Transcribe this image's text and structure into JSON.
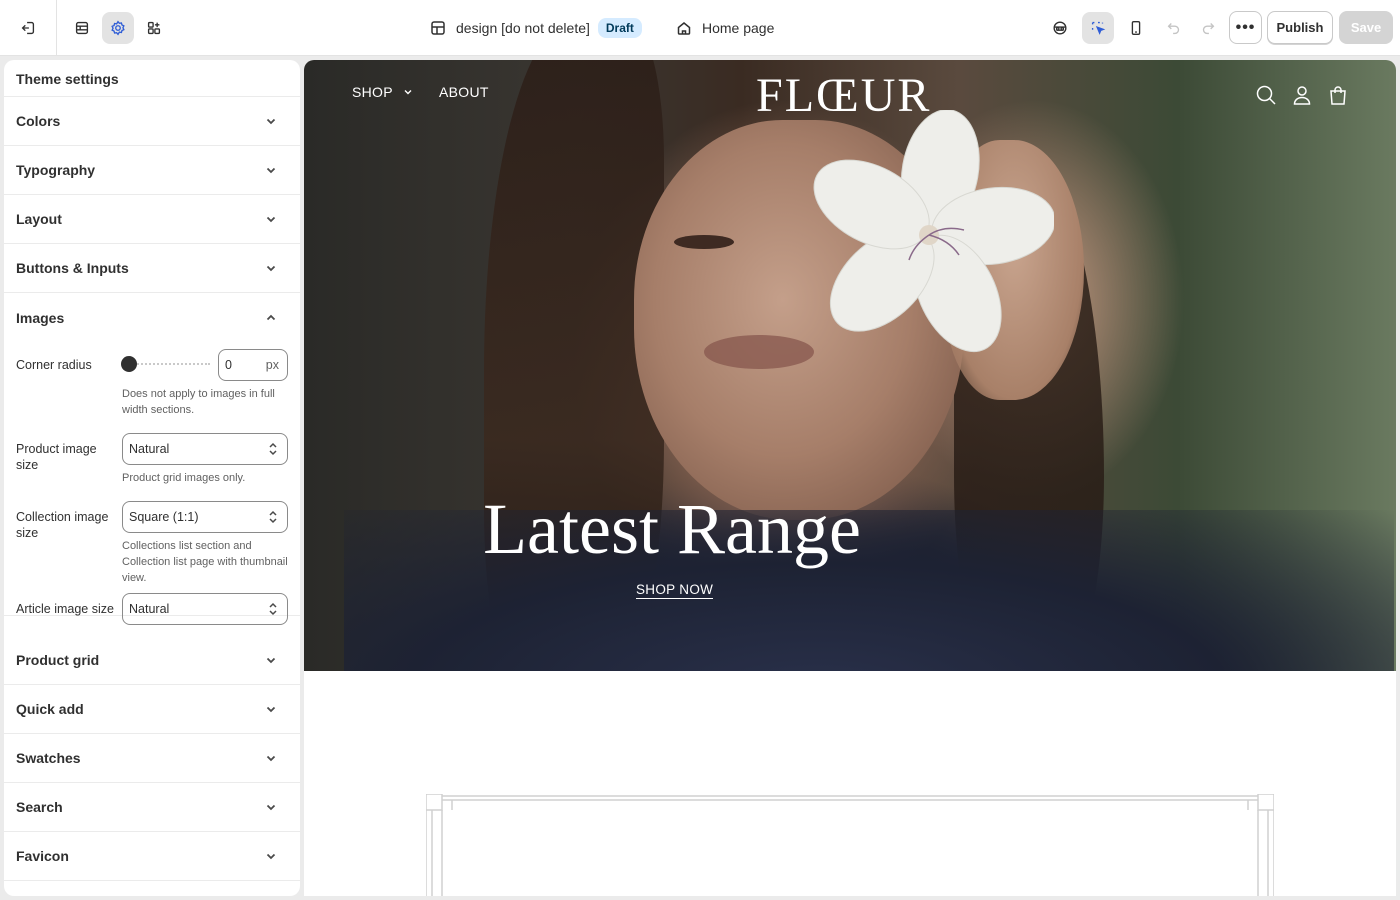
{
  "topbar": {
    "theme_name": "design [do not delete]",
    "status_badge": "Draft",
    "page_name": "Home page",
    "publish_label": "Publish",
    "save_label": "Save",
    "more_label": "•••"
  },
  "sidebar": {
    "title": "Theme settings",
    "sections_top": [
      {
        "label": "Colors"
      },
      {
        "label": "Typography"
      },
      {
        "label": "Layout"
      },
      {
        "label": "Buttons & Inputs"
      }
    ],
    "images": {
      "label": "Images",
      "corner_radius": {
        "label": "Corner radius",
        "value": "0",
        "unit": "px",
        "help": "Does not apply to images in full width sections.",
        "slider_fraction": 0
      },
      "product_image_size": {
        "label": "Product image size",
        "value": "Natural",
        "help": "Product grid images only."
      },
      "collection_image_size": {
        "label": "Collection image size",
        "value": "Square (1:1)",
        "help": "Collections list section and Collection list page with thumbnail view."
      },
      "article_image_size": {
        "label": "Article image size",
        "value": "Natural"
      }
    },
    "sections_bottom": [
      {
        "label": "Product grid"
      },
      {
        "label": "Quick add"
      },
      {
        "label": "Swatches"
      },
      {
        "label": "Search"
      },
      {
        "label": "Favicon"
      }
    ]
  },
  "preview": {
    "nav_shop": "SHOP",
    "nav_about": "ABOUT",
    "logo": "FLŒUR",
    "hero_title": "Latest Range",
    "hero_cta": "SHOP NOW"
  },
  "colors": {
    "accent": "#2f5dd6",
    "badge_bg": "#d5ebff",
    "save_disabled": "#d4d4d4"
  }
}
